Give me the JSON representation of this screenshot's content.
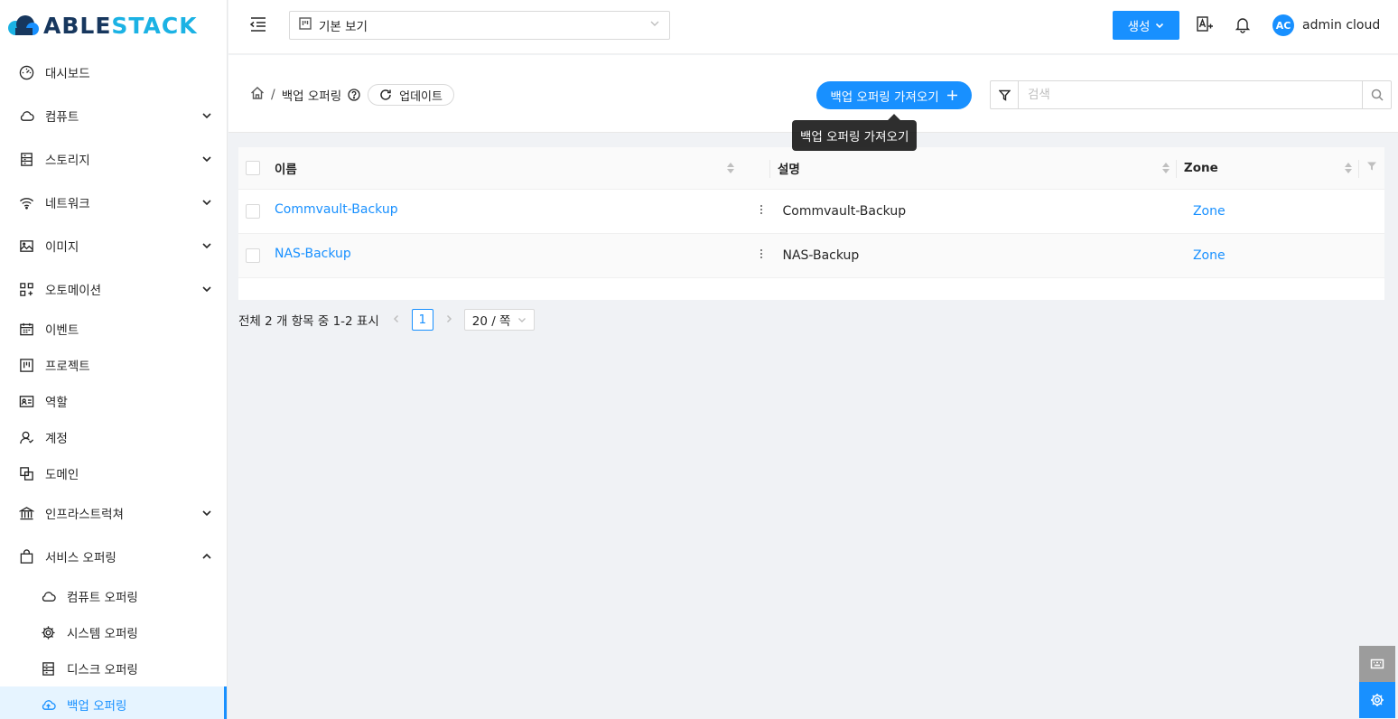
{
  "brand": {
    "part1": "ABLE",
    "part2": "STACK"
  },
  "sidebar": {
    "items": [
      {
        "label": "대시보드",
        "icon": "dashboard-icon"
      },
      {
        "label": "컴퓨트",
        "icon": "cloud-icon",
        "arrow": "down"
      },
      {
        "label": "스토리지",
        "icon": "storage-icon",
        "arrow": "down"
      },
      {
        "label": "네트워크",
        "icon": "wifi-icon",
        "arrow": "down"
      },
      {
        "label": "이미지",
        "icon": "image-icon",
        "arrow": "down"
      },
      {
        "label": "오토메이션",
        "icon": "automation-icon",
        "arrow": "down"
      },
      {
        "label": "이벤트",
        "icon": "calendar-icon"
      },
      {
        "label": "프로젝트",
        "icon": "project-icon"
      },
      {
        "label": "역할",
        "icon": "id-card-icon"
      },
      {
        "label": "계정",
        "icon": "user-icon"
      },
      {
        "label": "도메인",
        "icon": "domain-icon"
      },
      {
        "label": "인프라스트럭쳐",
        "icon": "bank-icon",
        "arrow": "down"
      },
      {
        "label": "서비스 오퍼링",
        "icon": "shopping-icon",
        "arrow": "up"
      }
    ],
    "sub_items": [
      {
        "label": "컴퓨트 오퍼링",
        "icon": "cloud-icon"
      },
      {
        "label": "시스템 오퍼링",
        "icon": "gear-icon"
      },
      {
        "label": "디스크 오퍼링",
        "icon": "disk-icon"
      },
      {
        "label": "백업 오퍼링",
        "icon": "cloud-upload-icon",
        "selected": true
      }
    ]
  },
  "header": {
    "project_select": "기본 보기",
    "create_label": "생성",
    "user": {
      "initials": "AC",
      "name": "admin cloud"
    }
  },
  "breadcrumb": {
    "separator": "/",
    "current": "백업 오퍼링",
    "refresh_label": "업데이트"
  },
  "toolbar": {
    "import_label": "백업 오퍼링 가져오기",
    "search_placeholder": "검색",
    "tooltip": "백업 오퍼링 가져오기"
  },
  "table": {
    "columns": {
      "name": "이름",
      "description": "설명",
      "zone": "Zone"
    },
    "rows": [
      {
        "name": "Commvault-Backup",
        "description": "Commvault-Backup",
        "zone": "Zone"
      },
      {
        "name": "NAS-Backup",
        "description": "NAS-Backup",
        "zone": "Zone"
      }
    ]
  },
  "pagination": {
    "summary": "전체 2 개 항목 중 1-2 표시",
    "current_page": "1",
    "page_size": "20 / 쪽"
  },
  "colors": {
    "primary": "#1890ff",
    "brand_dark": "#17375e",
    "brand_light": "#1bb2e4"
  }
}
